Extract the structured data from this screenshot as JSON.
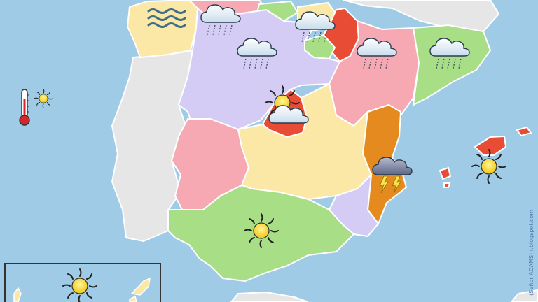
{
  "map": {
    "country": "Spain",
    "colors": {
      "sea": "#9fcbe6",
      "foreign_land": "#e6e6e6",
      "galicia": "#fbe7a6",
      "castilla_leon": "#d4ccf5",
      "asturias": "#f6a9b3",
      "cantabria": "#a7de86",
      "basque": "#fbe7a6",
      "navarra": "#e84c34",
      "la_rioja": "#a7de86",
      "aragon": "#f6a9b3",
      "catalonia": "#a7de86",
      "madrid": "#e84c34",
      "extremadura": "#f6a9b3",
      "castilla_la_mancha": "#fbe7a6",
      "valencia": "#e58a1f",
      "murcia": "#d4ccf5",
      "andalusia": "#a7de86",
      "balearic": "#e84c34"
    },
    "weather_icons": [
      {
        "region": "galicia",
        "icon": "fog-icon"
      },
      {
        "region": "asturias",
        "icon": "rain-icon"
      },
      {
        "region": "basque",
        "icon": "rain-icon"
      },
      {
        "region": "castilla_leon",
        "icon": "rain-icon"
      },
      {
        "region": "aragon",
        "icon": "rain-icon"
      },
      {
        "region": "catalonia",
        "icon": "rain-icon"
      },
      {
        "region": "madrid",
        "icon": "sun-icon"
      },
      {
        "region": "madrid",
        "icon": "cloud-icon"
      },
      {
        "region": "valencia",
        "icon": "storm-icon"
      },
      {
        "region": "balearic",
        "icon": "sun-icon"
      },
      {
        "region": "andalusia",
        "icon": "sun-icon"
      },
      {
        "region": "canary",
        "icon": "sun-icon"
      }
    ],
    "legend_icons": [
      "thermometer-icon",
      "sun-icon"
    ],
    "credit": "(Señor ADAMS)",
    "credit_url": "r.blogspot.com"
  }
}
